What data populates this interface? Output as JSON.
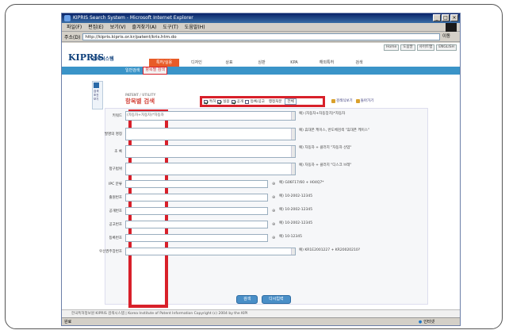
{
  "window": {
    "title": "KIPRIS Search System - Microsoft Internet Explorer",
    "menus": [
      "파일(F)",
      "편집(E)",
      "보기(V)",
      "즐겨찾기(A)",
      "도구(T)",
      "도움말(H)"
    ],
    "address_label": "주소(D)",
    "address": "http://kipris.kipris.or.kr/patent/kris.htm.do",
    "go_label": "이동"
  },
  "site": {
    "top_links": [
      "Home",
      "도움말",
      "사이트맵",
      "ENGLISH"
    ],
    "logo": "KIPRIS",
    "logo_sub": "검색시스템",
    "gnb": [
      "특허/실용",
      "디자인",
      "상표",
      "심판",
      "KPA",
      "해외특허",
      "검색"
    ],
    "gnb_active_index": 0,
    "subnav": [
      "일반검색",
      "항목별 검색"
    ],
    "subnav_active_index": 1,
    "left_box_label": "검색 조건 보기"
  },
  "search": {
    "title_small": "PATENT / UTILITY",
    "title": "항목별 검색",
    "options": [
      {
        "label": "특허",
        "checked": true
      },
      {
        "label": "실용",
        "checked": true
      },
      {
        "label": "공개",
        "checked": true
      },
      {
        "label": "등록/공고",
        "checked": false
      }
    ],
    "status_label": "행정처분",
    "status_value": "전체",
    "extra": [
      "검색식보기",
      "돌아가기"
    ]
  },
  "fields": [
    {
      "label": "키워드",
      "value": "(자동차+자동차)*자동차",
      "ex": "예) (자동차+차동장치)*자동차"
    },
    {
      "label": "발명의 명칭",
      "value": "",
      "ex": "예) 휴대폰 케이스, 반도체검색 \"휴대폰 케이스\""
    },
    {
      "label": "초 록",
      "value": "",
      "ex": "예) 자동차 + 클러치 \"자동차 산업\""
    },
    {
      "label": "청구범위",
      "value": "",
      "ex": "예) 자동차 + 클러치 \"디스크 브레\""
    },
    {
      "label": "IPC 분류",
      "value": "",
      "ex": "예) G06F17/60 + H04Q7*"
    },
    {
      "label": "출원번호",
      "value": "",
      "ex": "예) 10-2002-12345"
    },
    {
      "label": "공개번호",
      "value": "",
      "ex": "예) 10-2002-12345"
    },
    {
      "label": "공고번호",
      "value": "",
      "ex": "예) 10-2002-12345"
    },
    {
      "label": "등록번호",
      "value": "",
      "ex": "예) 10-12345"
    },
    {
      "label": "우선권주장번호",
      "value": "",
      "ex": "예) KR1E2001227 + KR20020210?"
    }
  ],
  "buttons": {
    "search": "검색",
    "reset": "다시입력"
  },
  "footer": "한국특허정보원 KIPRIS 검색시스템  |  Korea Institute of Patent Information  Copyright (c) 2004 by the KIPI",
  "status": {
    "left": "완료",
    "right": "인터넷"
  }
}
